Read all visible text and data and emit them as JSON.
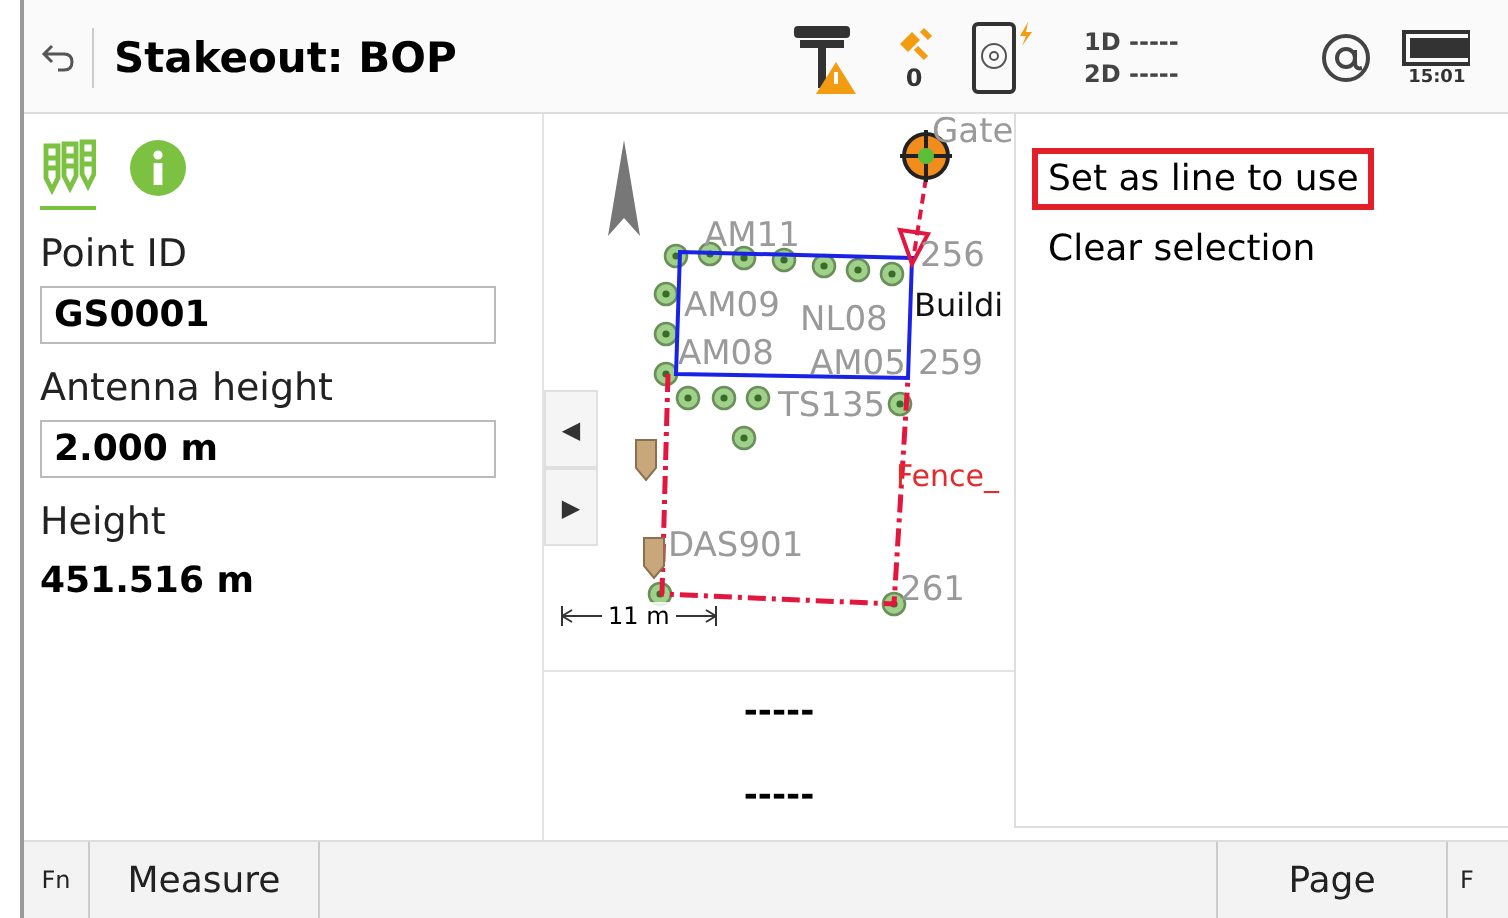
{
  "header": {
    "title": "Stakeout: BOP",
    "satellites": "0",
    "line_1d": "1D -----",
    "line_2d": "2D -----",
    "time": "15:01"
  },
  "tabs": [
    {
      "kind": "points",
      "selected": true
    },
    {
      "kind": "info",
      "selected": false
    }
  ],
  "fields": [
    {
      "kind": "input",
      "label": "Point ID",
      "value": "GS0001"
    },
    {
      "kind": "input",
      "label": "Antenna height",
      "value": "2.000 m"
    },
    {
      "kind": "readout",
      "label": "Height",
      "value": "451.516 m"
    }
  ],
  "map": {
    "labels": [
      {
        "text": "Gate",
        "kind": "point"
      },
      {
        "text": "AM11",
        "kind": "point"
      },
      {
        "text": "256",
        "kind": "point"
      },
      {
        "text": "AM09",
        "kind": "point"
      },
      {
        "text": "NL08",
        "kind": "point"
      },
      {
        "text": "Buildi",
        "kind": "feature"
      },
      {
        "text": "AM08",
        "kind": "point"
      },
      {
        "text": "AM05",
        "kind": "point"
      },
      {
        "text": "259",
        "kind": "point"
      },
      {
        "text": "TS135",
        "kind": "point"
      },
      {
        "text": "Fence_",
        "kind": "line"
      },
      {
        "text": "DAS901",
        "kind": "point"
      },
      {
        "text": "261",
        "kind": "point"
      }
    ],
    "scale": "11 m",
    "pan_buttons": [
      "◀",
      "▶"
    ]
  },
  "readouts": [
    "-----",
    "-----"
  ],
  "menu": [
    {
      "label": "Set as line to use",
      "selected": true
    },
    {
      "label": "Clear selection",
      "selected": false
    }
  ],
  "softkeys": [
    {
      "label": "Fn",
      "kind": "fn"
    },
    {
      "label": "Measure",
      "kind": "wide"
    },
    {
      "kind": "spacer"
    },
    {
      "label": "Page",
      "kind": "wide"
    },
    {
      "label": "F",
      "kind": "fn"
    }
  ]
}
